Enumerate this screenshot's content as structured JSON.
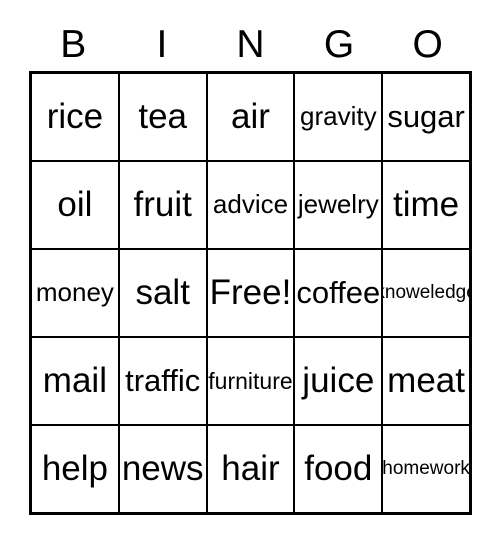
{
  "card": {
    "title": "BINGO",
    "header_letters": [
      "B",
      "I",
      "N",
      "G",
      "O"
    ],
    "free_space_label": "Free!",
    "colors": {
      "grid_line": "#000000",
      "text": "#000000",
      "background": "#ffffff"
    },
    "rows": [
      [
        {
          "label": "rice",
          "size": "xl"
        },
        {
          "label": "tea",
          "size": "xl"
        },
        {
          "label": "air",
          "size": "xl"
        },
        {
          "label": "gravity",
          "size": "md"
        },
        {
          "label": "sugar",
          "size": "lg"
        }
      ],
      [
        {
          "label": "oil",
          "size": "xl"
        },
        {
          "label": "fruit",
          "size": "xl"
        },
        {
          "label": "advice",
          "size": "md"
        },
        {
          "label": "jewelry",
          "size": "md"
        },
        {
          "label": "time",
          "size": "xl"
        }
      ],
      [
        {
          "label": "money",
          "size": "md"
        },
        {
          "label": "salt",
          "size": "xl"
        },
        {
          "label": "Free!",
          "size": "xl"
        },
        {
          "label": "coffee",
          "size": "lg"
        },
        {
          "label": "knoweledge",
          "size": "xs"
        }
      ],
      [
        {
          "label": "mail",
          "size": "xl"
        },
        {
          "label": "traffic",
          "size": "lg"
        },
        {
          "label": "furniture",
          "size": "sm"
        },
        {
          "label": "juice",
          "size": "xl"
        },
        {
          "label": "meat",
          "size": "xl"
        }
      ],
      [
        {
          "label": "help",
          "size": "xl"
        },
        {
          "label": "news",
          "size": "xl"
        },
        {
          "label": "hair",
          "size": "xl"
        },
        {
          "label": "food",
          "size": "xl"
        },
        {
          "label": "homework",
          "size": "xs"
        }
      ]
    ]
  }
}
